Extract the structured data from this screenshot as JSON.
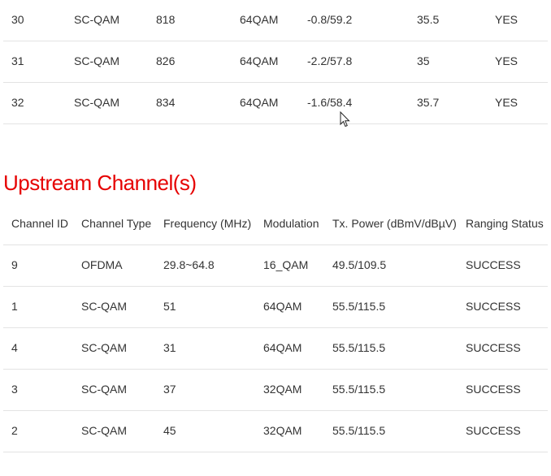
{
  "downstream": {
    "rows": [
      [
        "30",
        "SC-QAM",
        "818",
        "64QAM",
        "-0.8/59.2",
        "35.5",
        "YES"
      ],
      [
        "31",
        "SC-QAM",
        "826",
        "64QAM",
        "-2.2/57.8",
        "35",
        "YES"
      ],
      [
        "32",
        "SC-QAM",
        "834",
        "64QAM",
        "-1.6/58.4",
        "35.7",
        "YES"
      ]
    ]
  },
  "upstream": {
    "title": "Upstream Channel(s)",
    "title_color": "#e60000",
    "headers": [
      "Channel ID",
      "Channel Type",
      "Frequency (MHz)",
      "Modulation",
      "Tx. Power (dBmV/dBµV)",
      "Ranging Status"
    ],
    "rows": [
      [
        "9",
        "OFDMA",
        "29.8~64.8",
        "16_QAM",
        "49.5/109.5",
        "SUCCESS"
      ],
      [
        "1",
        "SC-QAM",
        "51",
        "64QAM",
        "55.5/115.5",
        "SUCCESS"
      ],
      [
        "4",
        "SC-QAM",
        "31",
        "64QAM",
        "55.5/115.5",
        "SUCCESS"
      ],
      [
        "3",
        "SC-QAM",
        "37",
        "32QAM",
        "55.5/115.5",
        "SUCCESS"
      ],
      [
        "2",
        "SC-QAM",
        "45",
        "32QAM",
        "55.5/115.5",
        "SUCCESS"
      ]
    ]
  },
  "cursor_icon": "mouse-pointer-icon"
}
